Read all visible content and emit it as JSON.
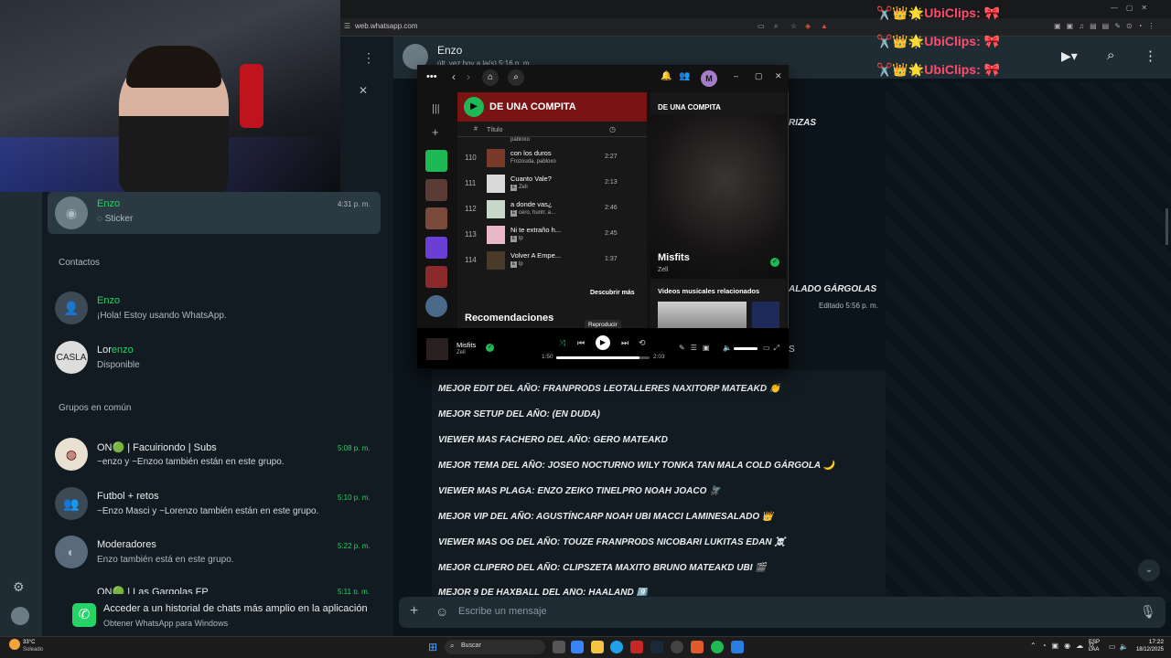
{
  "browser": {
    "url": "web.whatsapp.com"
  },
  "overlay": {
    "clips": [
      "✂️👑🌟UbiClips: 🎀",
      "✂️👑🌟UbiClips: 🎀",
      "✂️👑🌟UbiClips: 🎀"
    ]
  },
  "left": {
    "search_clear": "✕",
    "top_chat": {
      "name": "Enzo",
      "preview": "Sticker",
      "time": "4:31 p. m."
    },
    "contacts_title": "Contactos",
    "contacts": [
      {
        "name": "Enzo",
        "status": "¡Hola! Estoy usando WhatsApp."
      },
      {
        "name_pre": "Lor",
        "name_hl": "enzo",
        "status": "Disponible"
      }
    ],
    "groups_title": "Grupos en común",
    "groups": [
      {
        "name": "ON🟢 | Facuiriondo | Subs",
        "members": "~enzo y ~Enzoo también están en este grupo.",
        "time": "5:08 p. m."
      },
      {
        "name": "Futbol + retos",
        "members": "~Enzo Masci y ~Lorenzo también están en este grupo.",
        "time": "5:10 p. m."
      },
      {
        "name": "Moderadores",
        "members": "Enzo también está en este grupo.",
        "time": "5:22 p. m."
      },
      {
        "name": "ON🟢 | Las Gargolas FP",
        "members": "",
        "time": "5:11 p. m."
      }
    ],
    "banner": {
      "title": "Acceder a un historial de chats más amplio en la aplicación",
      "subtitle": "Obtener WhatsApp para Windows"
    }
  },
  "chat": {
    "contact_name": "Enzo",
    "last_seen": "últ. vez hoy a la(s) 5:16 p. m.",
    "fragments": [
      "RIZAS",
      "ALADO GÁRGOLAS",
      "Editado 5:56 p. m."
    ],
    "messages": [
      "MEJOR EDIT DEL AÑO: FRANPRODS LEOTALLERES NAXITORP MATEAKD 👏",
      "MEJOR SETUP DEL AÑO: (EN DUDA)",
      "VIEWER MAS FACHERO DEL AÑO: GERO MATEAKD",
      "MEJOR TEMA DEL AÑO: JOSEO NOCTURNO WILY TONKA TAN MALA COLD GÁRGOLA 🌙",
      "VIEWER MAS PLAGA: ENZO ZEIKO TINELPRO NOAH JOACO 🪰",
      "MEJOR VIP DEL AÑO: AGUSTÍNCARP NOAH UBI MACCI LAMINESALADO 👑",
      "VIEWER MAS OG DEL AÑO: TOUZE FRANPRODS NICOBARI LUKITAS EDAN ☠️",
      "MEJOR CLIPERO DEL AÑO: CLIPSZETA MAXITO BRUNO MATEAKD UBI 🎬",
      "MEJOR 9 DE HAXBALL DEL AÑO: HAALAND 9️⃣"
    ],
    "composer_placeholder": "Escribe un mensaje"
  },
  "spotify": {
    "avatar_letter": "M",
    "playlist_title": "DE UNA COMPITA",
    "col_num": "#",
    "col_title": "Título",
    "partial_artist": "pabloxo",
    "tracks": [
      {
        "n": "110",
        "title": "con los duros",
        "artist": "Frozouda, pabloxo",
        "dur": "2:27",
        "explicit": false
      },
      {
        "n": "111",
        "title": "Cuanto Vale?",
        "artist": "Zell",
        "dur": "2:13",
        "explicit": true
      },
      {
        "n": "112",
        "title": "a donde vas¿",
        "artist": "cero, huntr, a...",
        "dur": "2:46",
        "explicit": true
      },
      {
        "n": "113",
        "title": "Ni te extraño h...",
        "artist": "lp",
        "dur": "2:45",
        "explicit": true
      },
      {
        "n": "114",
        "title": "Volver A Empe...",
        "artist": "lp",
        "dur": "1:37",
        "explicit": true
      }
    ],
    "discover": "Descubrir más",
    "recommendations": "Recomendaciones",
    "right_title": "DE UNA COMPITA",
    "now_title": "Misfits",
    "now_artist": "Zell",
    "videos_title": "Videos musicales relacionados",
    "tooltip": "Reproducir",
    "player": {
      "title": "Misfits",
      "artist": "Zell",
      "elapsed": "1:50",
      "total": "2:03",
      "progress": 0.89
    }
  },
  "taskbar": {
    "weather_temp": "33°C",
    "weather_desc": "Soleado",
    "search": "Buscar",
    "lang1": "ESP",
    "lang2": "LAA",
    "time": "17:22",
    "date": "18/12/2025"
  },
  "colors": {
    "whatsapp_green": "#25d366",
    "spotify_green": "#1db954",
    "playlist_red": "#7a1414"
  }
}
